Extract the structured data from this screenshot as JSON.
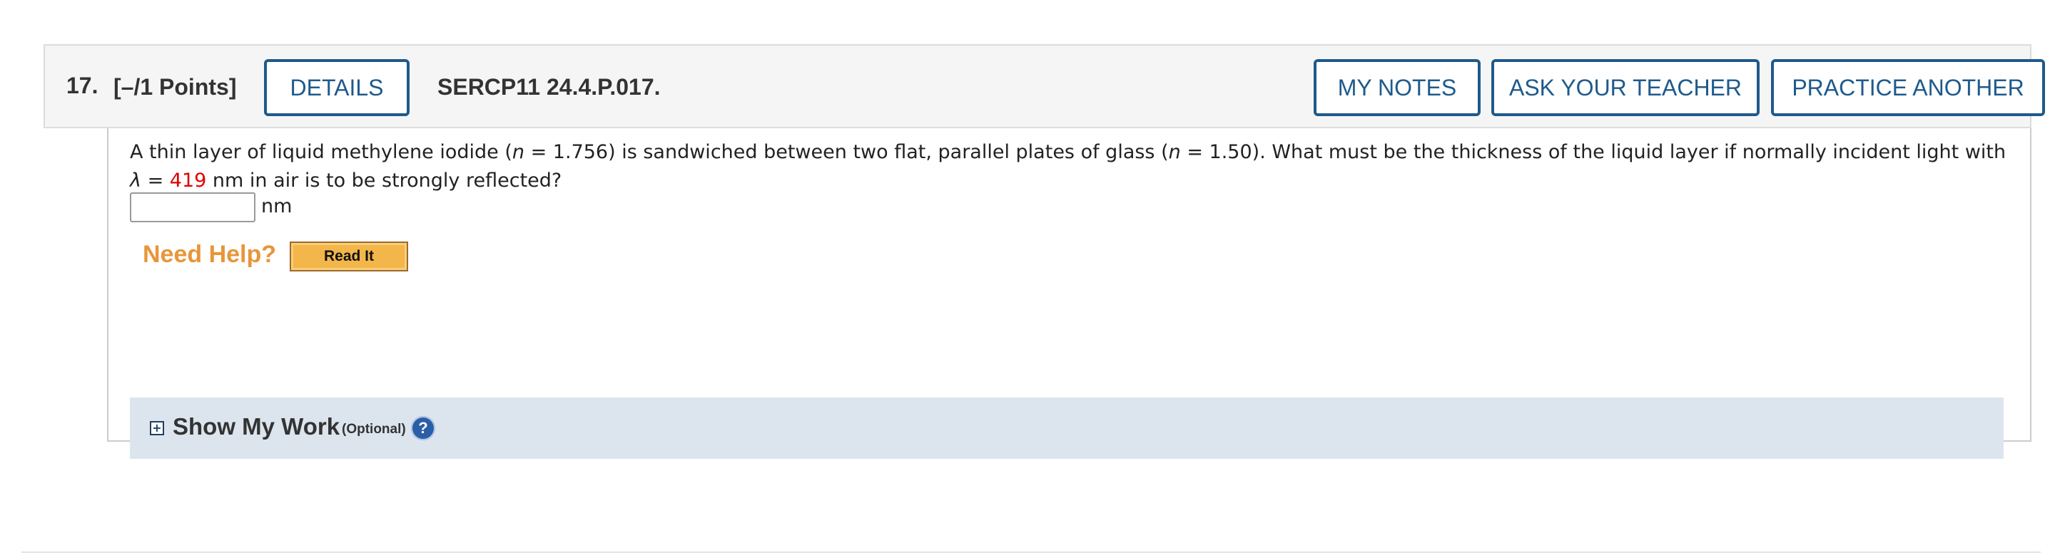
{
  "question": {
    "number": "17.",
    "points": "[–/1 Points]",
    "code": "SERCP11 24.4.P.017.",
    "buttons": {
      "details": "DETAILS",
      "my_notes": "MY NOTES",
      "ask_teacher": "ASK YOUR TEACHER",
      "practice_another": "PRACTICE ANOTHER"
    },
    "prompt": {
      "part1": "A thin layer of liquid methylene iodide (",
      "n_symbol": "n",
      "part2": " = 1.756) is sandwiched between two flat, parallel plates of glass (",
      "part3": " = 1.50). What must be the thickness of the liquid layer if normally incident light with",
      "lambda_symbol": "λ",
      "part4": " = ",
      "wavelength_value": "419",
      "part5": " nm in air is to be strongly reflected?"
    },
    "answer": {
      "value": "",
      "unit": "nm"
    },
    "help": {
      "label": "Need Help?",
      "read_it": "Read It"
    },
    "show_my_work": {
      "toggle": "+",
      "title": "Show My Work",
      "optional": "(Optional)",
      "help_icon": "?"
    }
  },
  "colors": {
    "button_blue": "#1e5a8c",
    "highlight_red": "#e00000",
    "need_help_orange": "#e8963a",
    "show_work_bg": "#dce5ee"
  }
}
